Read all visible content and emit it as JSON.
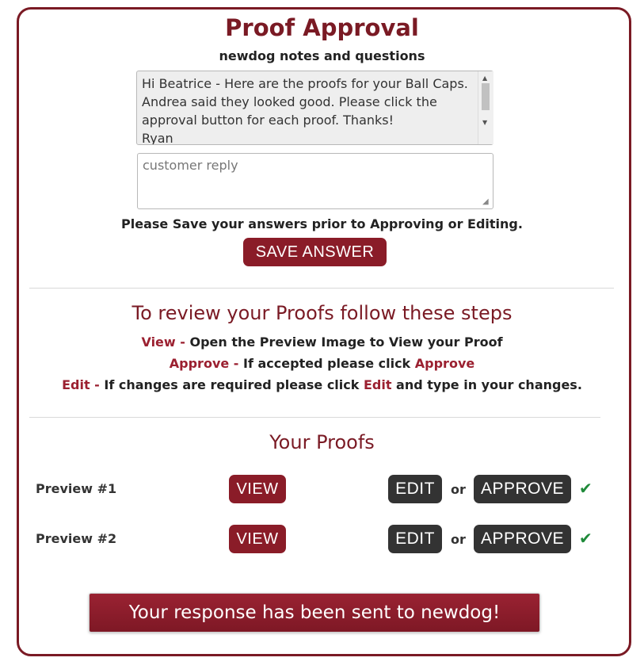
{
  "header": {
    "title": "Proof Approval",
    "notes_heading": "newdog notes and questions"
  },
  "notes": {
    "text": "Hi Beatrice - Here are the proofs for your Ball Caps. Andrea said they looked good. Please click the approval button for each proof. Thanks!\nRyan"
  },
  "reply": {
    "placeholder": "customer reply",
    "value": ""
  },
  "save": {
    "instruction": "Please Save your answers prior to Approving or Editing.",
    "button_label": "SAVE ANSWER"
  },
  "steps": {
    "title": "To review your Proofs follow these steps",
    "items": [
      {
        "keyword": "View -",
        "text": " Open the Preview Image to View your Proof"
      },
      {
        "keyword": "Approve -",
        "text": " If accepted please click ",
        "keyword2": "Approve",
        "text2": ""
      },
      {
        "keyword": "Edit -",
        "text": " If changes are required please click ",
        "keyword2": "Edit",
        "text2": " and type in your changes."
      }
    ]
  },
  "proofs": {
    "title": "Your Proofs",
    "rows": [
      {
        "label": "Preview #1",
        "view": "VIEW",
        "edit": "EDIT",
        "or": "or",
        "approve": "APPROVE",
        "status": "✔"
      },
      {
        "label": "Preview #2",
        "view": "VIEW",
        "edit": "EDIT",
        "or": "or",
        "approve": "APPROVE",
        "status": "✔"
      }
    ]
  },
  "footer": {
    "response_message": "Your response has been sent to newdog!"
  },
  "colors": {
    "brand": "#7a1a24",
    "button_red": "#8a1c28",
    "button_dark": "#333333",
    "approved_check": "#1f8a3a"
  }
}
